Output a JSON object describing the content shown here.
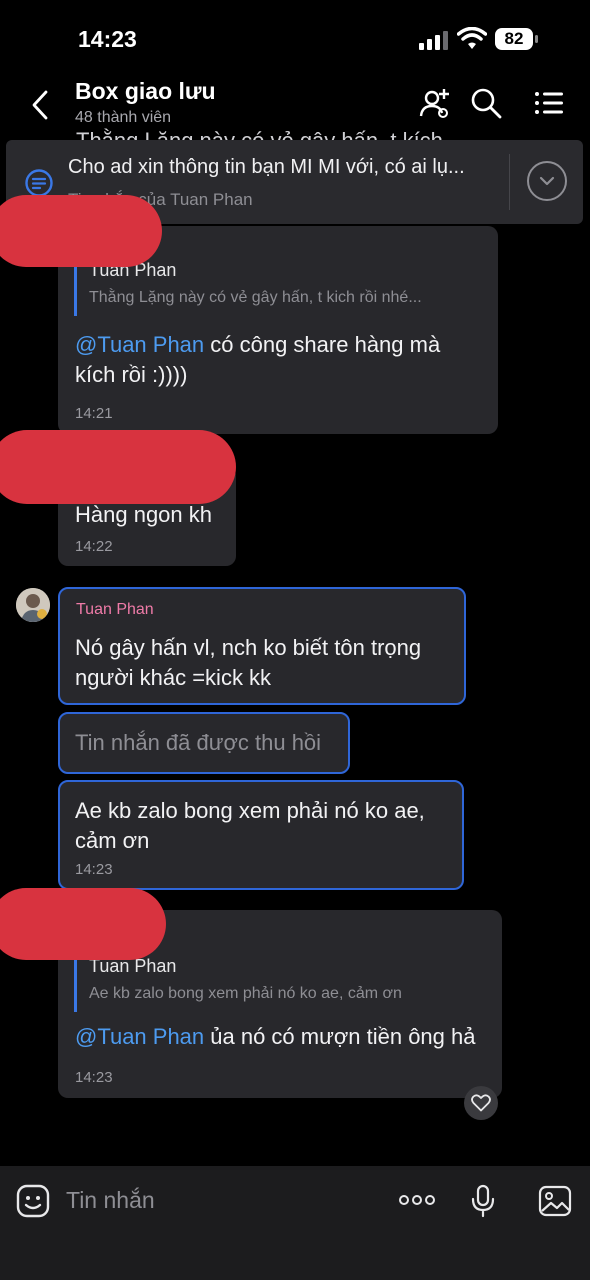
{
  "status": {
    "time": "14:23",
    "battery": "82"
  },
  "header": {
    "title": "Box giao lưu",
    "subtitle": "48 thành viên"
  },
  "pinned": {
    "text": "Cho ad xin thông tin bạn MI MI với, có ai lụ...",
    "sub": "Tin nhắn của Tuan Phan",
    "behind": "Thằng Lặng này có vẻ gây hấn, t kích"
  },
  "messages": [
    {
      "quote_name": "Tuan Phan",
      "quote_text": "Thằng Lặng này có vẻ gây hấn, t kich rồi nhé...",
      "mention": "@Tuan Phan",
      "text_line1": " có công share hàng mà",
      "text_line2": "kích rồi :))))",
      "time": "14:21"
    },
    {
      "text": "Hàng ngon kh",
      "time": "14:22"
    },
    {
      "sender": "Tuan Phan",
      "text_line1": "Nó gây hấn vl, nch ko biết tôn trọng",
      "text_line2": "người khác =kick kk"
    },
    {
      "text": "Tin nhắn đã được thu hồi"
    },
    {
      "text_line1": "Ae kb zalo bong xem phải nó ko ae,",
      "text_line2": "cảm ơn",
      "time": "14:23"
    },
    {
      "quote_name": "Tuan Phan",
      "quote_text": "Ae kb zalo bong xem phải nó ko ae, cảm ơn",
      "mention": "@Tuan Phan",
      "text": " ủa nó có mượn tiền ông hả",
      "time": "14:23"
    }
  ],
  "input": {
    "placeholder": "Tin nhắn"
  },
  "icons": {
    "back": "back-icon",
    "add_member": "add-member-icon",
    "search": "search-icon",
    "menu": "menu-icon",
    "emoji": "emoji-icon",
    "more": "more-icon",
    "mic": "mic-icon",
    "image": "image-icon",
    "heart": "heart-icon"
  },
  "colors": {
    "accent": "#2f66d8",
    "mention": "#4d9bf0",
    "sender": "#ef7ba8",
    "redaction": "#d8333f"
  }
}
